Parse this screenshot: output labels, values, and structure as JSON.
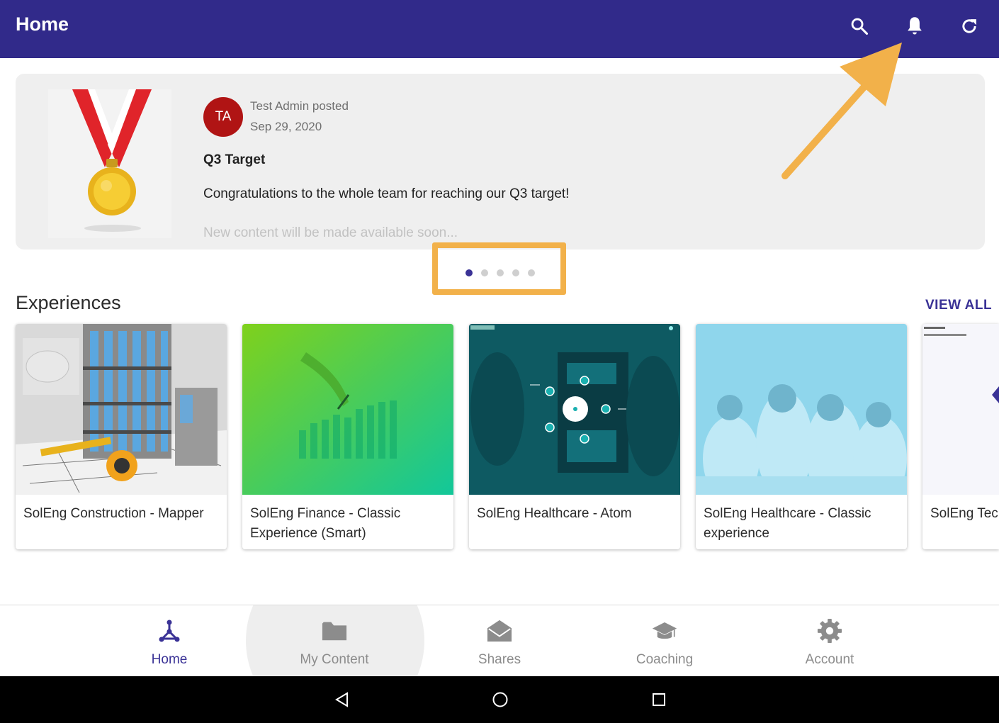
{
  "appbar": {
    "title": "Home",
    "icons": [
      "search-icon",
      "bell-icon",
      "refresh-icon"
    ]
  },
  "feed": {
    "avatar_initials": "TA",
    "author_line": "Test Admin posted",
    "date": "Sep 29, 2020",
    "title": "Q3 Target",
    "body": "Congratulations to the whole team for reaching our Q3 target!",
    "more": "New content will be made available soon...",
    "carousel_pages": 5,
    "carousel_active_index": 0
  },
  "experiences": {
    "heading": "Experiences",
    "view_all": "VIEW ALL",
    "cards": [
      {
        "title": "SolEng Construction - Mapper"
      },
      {
        "title": "SolEng Finance - Classic Experience (Smart)"
      },
      {
        "title": "SolEng Healthcare - Atom"
      },
      {
        "title": "SolEng Healthcare - Classic experience"
      },
      {
        "title": "SolEng Tech"
      }
    ]
  },
  "bottom_nav": {
    "items": [
      {
        "label": "Home",
        "icon": "home-network-icon",
        "active": true
      },
      {
        "label": "My Content",
        "icon": "folder-icon",
        "active": false
      },
      {
        "label": "Shares",
        "icon": "envelope-open-icon",
        "active": false
      },
      {
        "label": "Coaching",
        "icon": "graduation-cap-icon",
        "active": false
      },
      {
        "label": "Account",
        "icon": "gear-icon",
        "active": false
      }
    ]
  },
  "system_bar": {
    "buttons": [
      "back-icon",
      "home-circle-icon",
      "recents-icon"
    ]
  },
  "colors": {
    "appbar": "#312a8a",
    "accent": "#3a3296",
    "highlight": "#f2b14a",
    "avatar": "#b01414"
  }
}
